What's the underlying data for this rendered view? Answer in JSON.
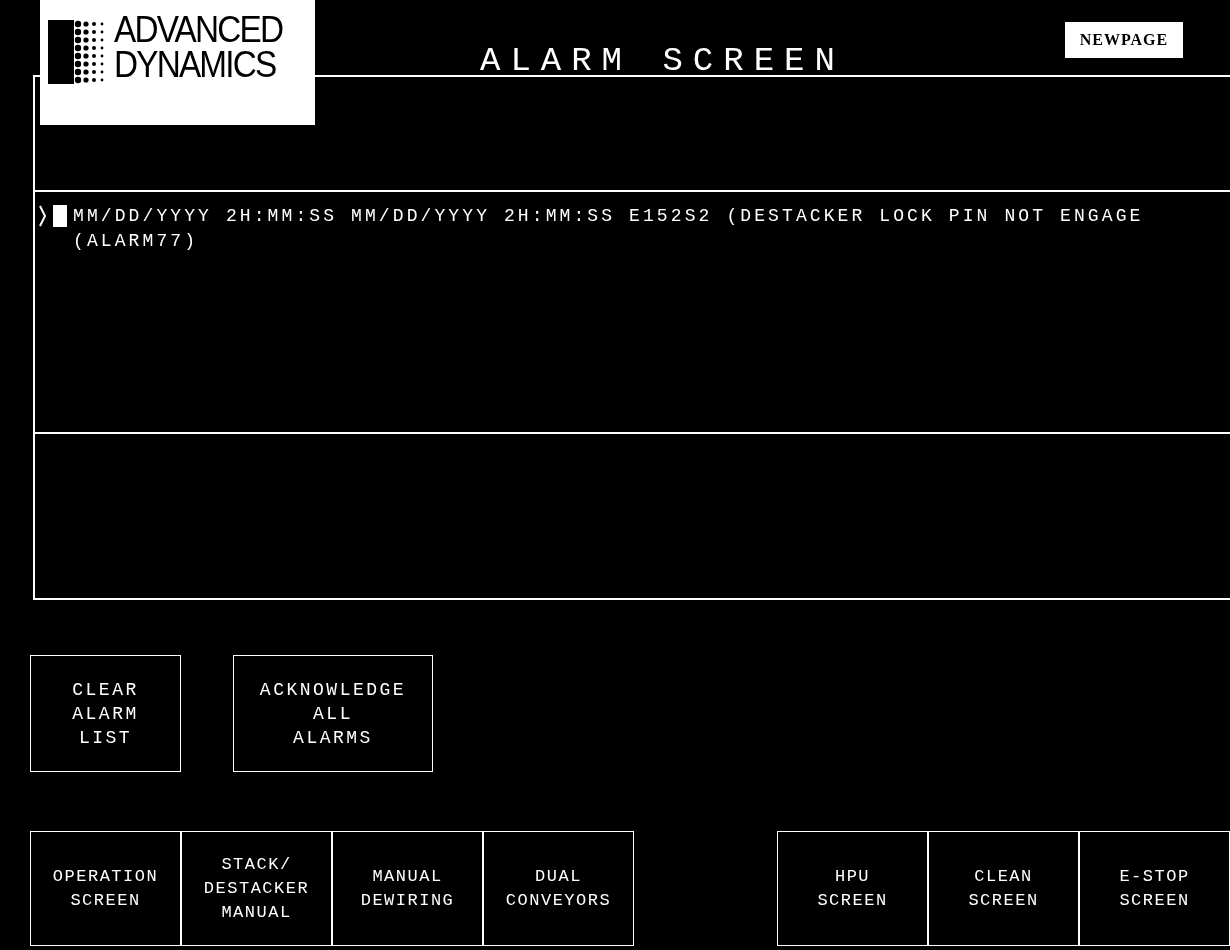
{
  "header": {
    "logo": {
      "line1": "ADVANCED",
      "line2": "DYNAMICS"
    },
    "title": "ALARM SCREEN",
    "newpage_button": "NEWPAGE"
  },
  "alarm_list": {
    "rows": [
      {
        "text": "MM/DD/YYYY 2H:MM:SS MM/DD/YYYY 2H:MM:SS E152S2 (DESTACKER LOCK PIN NOT ENGAGE (ALARM77)",
        "selected": true
      }
    ]
  },
  "alarm_actions": [
    {
      "lines": [
        "CLEAR",
        "ALARM",
        "LIST"
      ]
    },
    {
      "lines": [
        "ACKNOWLEDGE",
        "ALL",
        "ALARMS"
      ]
    }
  ],
  "nav_left": [
    {
      "lines": [
        "OPERATION",
        "SCREEN"
      ]
    },
    {
      "lines": [
        "STACK/",
        "DESTACKER",
        "MANUAL"
      ]
    },
    {
      "lines": [
        "MANUAL",
        "DEWIRING"
      ]
    },
    {
      "lines": [
        "DUAL",
        "CONVEYORS"
      ]
    }
  ],
  "nav_right": [
    {
      "lines": [
        "HPU",
        "SCREEN"
      ]
    },
    {
      "lines": [
        "CLEAN",
        "SCREEN"
      ]
    },
    {
      "lines": [
        "E-STOP",
        "SCREEN"
      ]
    }
  ]
}
